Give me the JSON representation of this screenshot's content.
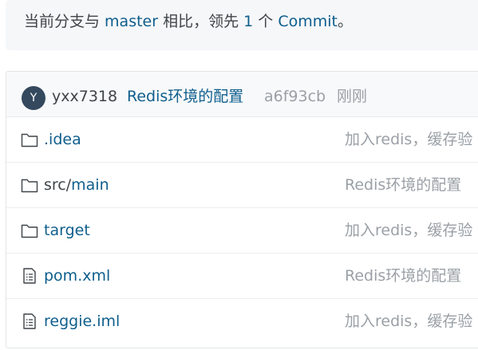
{
  "compare": {
    "prefix": "当前分支与 ",
    "branch": "master",
    "middle": " 相比，领先 ",
    "count": "1",
    "space": " 个 ",
    "commit_word": "Commit",
    "suffix": "。"
  },
  "latest_commit": {
    "avatar_letter": "Y",
    "author": "yxx7318",
    "message": "Redis环境的配置",
    "sha": "a6f93cb",
    "time": "刚刚"
  },
  "files": [
    {
      "type": "folder",
      "icon": "folder-icon",
      "prefix": "",
      "name": ".idea",
      "commit": "加入redis，缓存验"
    },
    {
      "type": "folder",
      "icon": "folder-icon",
      "prefix": "src/",
      "name": "main",
      "commit": "Redis环境的配置"
    },
    {
      "type": "folder",
      "icon": "folder-icon",
      "prefix": "",
      "name": "target",
      "commit": "加入redis，缓存验"
    },
    {
      "type": "file",
      "icon": "file-icon",
      "prefix": "",
      "name": "pom.xml",
      "commit": "Redis环境的配置"
    },
    {
      "type": "file",
      "icon": "file-icon",
      "prefix": "",
      "name": "reggie.iml",
      "commit": "加入redis，缓存验"
    }
  ],
  "colors": {
    "link": "#0f5e8d",
    "muted": "#9aa0a6",
    "text": "#3f4449",
    "avatar_bg": "#34495e"
  }
}
